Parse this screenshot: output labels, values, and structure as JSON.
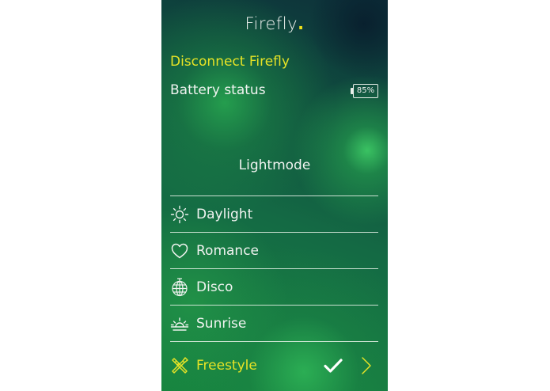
{
  "header": {
    "app_name": "Firefly",
    "app_name_dot": "."
  },
  "connection": {
    "disconnect_label": "Disconnect Firefly"
  },
  "battery": {
    "label": "Battery status",
    "percent_text": "85%"
  },
  "lightmode": {
    "title": "Lightmode",
    "modes": [
      {
        "label": "Daylight",
        "icon": "sun-icon"
      },
      {
        "label": "Romance",
        "icon": "heart-icon"
      },
      {
        "label": "Disco",
        "icon": "disco-ball-icon"
      },
      {
        "label": "Sunrise",
        "icon": "sunrise-icon"
      },
      {
        "label": "Freestyle",
        "icon": "freestyle-icon",
        "selected": true
      }
    ]
  },
  "colors": {
    "accent_yellow": "#e6e326",
    "text_white": "#f0f3f0",
    "bg_green": "#17853f",
    "bg_dark": "#0d2f3a"
  },
  "icons": {
    "confirm": "checkmark-icon",
    "next": "chevron-right-icon"
  }
}
